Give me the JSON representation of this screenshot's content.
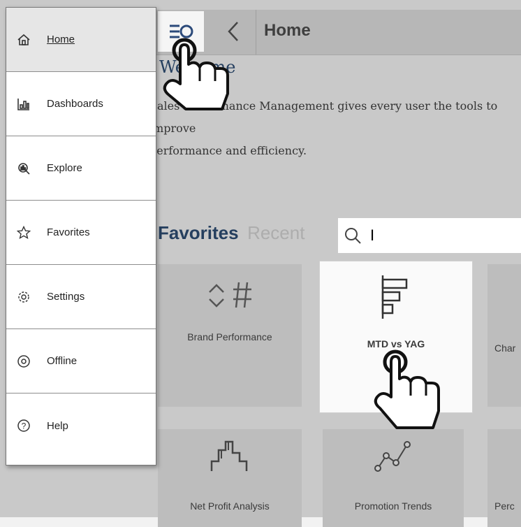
{
  "topbar": {
    "title": "Home"
  },
  "welcome": {
    "title": "Welcome",
    "text": "Sales Performance Management gives every user the tools to improve\nperformance and efficiency."
  },
  "favorites": {
    "tab_favorites": "Favorites",
    "tab_recent": "Recent",
    "search_value": "I"
  },
  "tiles": [
    {
      "label": "Brand Performance",
      "icon": "sort-hash-icon"
    },
    {
      "label": "MTD vs YAG",
      "icon": "horizontal-bar-chart-icon"
    },
    {
      "label": "Char",
      "icon": "chart-icon"
    },
    {
      "label": "Net Profit Analysis",
      "icon": "step-chart-icon"
    },
    {
      "label": "Promotion Trends",
      "icon": "line-trend-icon"
    },
    {
      "label": "Perc",
      "icon": "chart-icon"
    }
  ],
  "nav": [
    {
      "label": "Home",
      "icon": "home-icon"
    },
    {
      "label": "Dashboards",
      "icon": "dashboard-chart-icon"
    },
    {
      "label": "Explore",
      "icon": "explore-icon"
    },
    {
      "label": "Favorites",
      "icon": "star-icon"
    },
    {
      "label": "Settings",
      "icon": "gear-icon"
    },
    {
      "label": "Offline",
      "icon": "offline-icon"
    },
    {
      "label": "Help",
      "icon": "help-icon"
    }
  ],
  "colors": {
    "accent": "#253f5f",
    "overlay": "#c9c9c9",
    "drawer": "#ffffff"
  }
}
